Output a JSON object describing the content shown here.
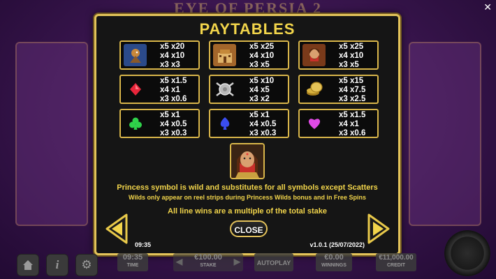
{
  "background": {
    "game_title": "EYE OF PERSIA 2"
  },
  "panel": {
    "title": "PAYTABLES",
    "symbols": [
      {
        "icon": "falcon-icon",
        "color": "#2b4a8a",
        "pays": [
          "x5  x20",
          "x4  x10",
          "x3  x3"
        ]
      },
      {
        "icon": "palace-icon",
        "color": "#a3662b",
        "pays": [
          "x5  x25",
          "x4  x10",
          "x3  x5"
        ]
      },
      {
        "icon": "woman-portrait-icon",
        "color": "#7a3a1a",
        "pays": [
          "x5  x25",
          "x4  x10",
          "x3  x5"
        ]
      },
      {
        "icon": "red-diamond-icon",
        "color": "#e8253a",
        "pays": [
          "x5  x1.5",
          "x4  x1",
          "x3  x0.6"
        ]
      },
      {
        "icon": "shield-swords-icon",
        "color": "#b9b9b9",
        "pays": [
          "x5  x10",
          "x4  x5",
          "x3  x2"
        ]
      },
      {
        "icon": "gold-coins-icon",
        "color": "#d8b23e",
        "pays": [
          "x5  x15",
          "x4  x7.5",
          "x3  x2.5"
        ]
      },
      {
        "icon": "green-club-icon",
        "color": "#2fd24a",
        "pays": [
          "x5  x1",
          "x4  x0.5",
          "x3  x0.3"
        ]
      },
      {
        "icon": "blue-spade-icon",
        "color": "#3a4df0",
        "pays": [
          "x5  x1",
          "x4  x0.5",
          "x3  x0.3"
        ]
      },
      {
        "icon": "pink-heart-icon",
        "color": "#e04ae6",
        "pays": [
          "x5  x1.5",
          "x4  x1",
          "x3  x0.6"
        ]
      }
    ],
    "wild_icon": "princess-wild-icon",
    "text_line1": "Princess symbol is wild and substitutes for all symbols except Scatters",
    "text_line2": "Wilds only appear on reel strips during Princess Wilds bonus and in Free Spins",
    "text_line3": "All line wins are a multiple of the total stake",
    "close_label": "CLOSE",
    "time": "09:35",
    "version": "v1.0.1 (25/07/2022)"
  },
  "bottom_bar": {
    "time_value": "09:35",
    "time_label": "TIME",
    "stake_value": "€100.00",
    "stake_label": "STAKE",
    "autoplay_label": "AUTOPLAY",
    "winnings_value": "€0.00",
    "winnings_label": "WINNINGS",
    "credit_value": "€11,000.00",
    "credit_label": "CREDIT"
  },
  "colors": {
    "accent_gold": "#f2d54b",
    "border_gold": "#d9b64a",
    "panel_bg": "#151515"
  }
}
